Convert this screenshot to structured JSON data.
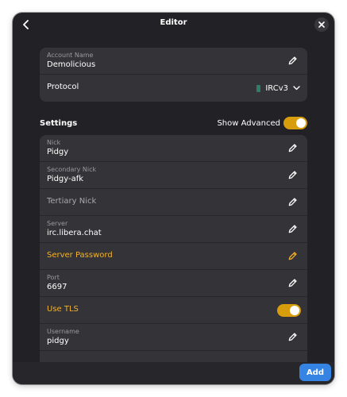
{
  "header": {
    "title": "Editor"
  },
  "account": {
    "name_label": "Account Name",
    "name_value": "Demolicious",
    "protocol_label": "Protocol",
    "protocol_value": "IRCv3"
  },
  "settings": {
    "section_title": "Settings",
    "show_advanced_label": "Show Advanced",
    "show_advanced_on": true,
    "nick_label": "Nick",
    "nick_value": "Pidgy",
    "secondary_nick_label": "Secondary Nick",
    "secondary_nick_value": "Pidgy-afk",
    "tertiary_nick_placeholder": "Tertiary Nick",
    "server_label": "Server",
    "server_value": "irc.libera.chat",
    "server_password_label": "Server Password",
    "port_label": "Port",
    "port_value": "6697",
    "use_tls_label": "Use TLS",
    "use_tls_on": true,
    "username_label": "Username",
    "username_value": "pidgy"
  },
  "footer": {
    "add_label": "Add"
  },
  "colors": {
    "accent": "#f2b12b",
    "switch_on": "#d89d0c",
    "primary_button": "#3584e4",
    "window_bg": "#222226",
    "card_bg": "#343438"
  },
  "icons": {
    "back": "chevron-left-icon",
    "close": "close-icon",
    "edit": "pencil-icon",
    "dropdown": "chevron-down-icon",
    "protocol": "protocol-icon"
  }
}
